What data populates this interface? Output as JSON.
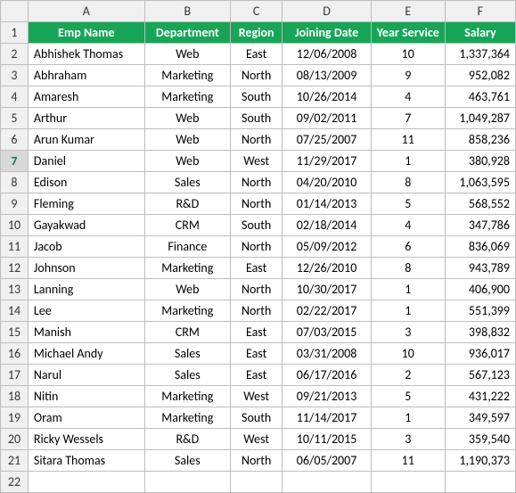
{
  "columns": [
    "A",
    "B",
    "C",
    "D",
    "E",
    "F"
  ],
  "headers": {
    "A": "Emp Name",
    "B": "Department",
    "C": "Region",
    "D": "Joining Date",
    "E": "Year Service",
    "F": "Salary"
  },
  "rows": [
    {
      "n": "2",
      "name": "Abhishek Thomas",
      "dept": "Web",
      "region": "East",
      "date": "12/06/2008",
      "years": "10",
      "salary": "1,337,364"
    },
    {
      "n": "3",
      "name": "Abhraham",
      "dept": "Marketing",
      "region": "North",
      "date": "08/13/2009",
      "years": "9",
      "salary": "952,082"
    },
    {
      "n": "4",
      "name": "Amaresh",
      "dept": "Marketing",
      "region": "South",
      "date": "10/26/2014",
      "years": "4",
      "salary": "463,761"
    },
    {
      "n": "5",
      "name": "Arthur",
      "dept": "Web",
      "region": "South",
      "date": "09/02/2011",
      "years": "7",
      "salary": "1,049,287"
    },
    {
      "n": "6",
      "name": "Arun Kumar",
      "dept": "Web",
      "region": "North",
      "date": "07/25/2007",
      "years": "11",
      "salary": "858,236"
    },
    {
      "n": "7",
      "name": "Daniel",
      "dept": "Web",
      "region": "West",
      "date": "11/29/2017",
      "years": "1",
      "salary": "380,928"
    },
    {
      "n": "8",
      "name": "Edison",
      "dept": "Sales",
      "region": "North",
      "date": "04/20/2010",
      "years": "8",
      "salary": "1,063,595"
    },
    {
      "n": "9",
      "name": "Fleming",
      "dept": "R&D",
      "region": "North",
      "date": "01/14/2013",
      "years": "5",
      "salary": "568,552"
    },
    {
      "n": "10",
      "name": "Gayakwad",
      "dept": "CRM",
      "region": "South",
      "date": "02/18/2014",
      "years": "4",
      "salary": "347,786"
    },
    {
      "n": "11",
      "name": "Jacob",
      "dept": "Finance",
      "region": "North",
      "date": "05/09/2012",
      "years": "6",
      "salary": "836,069"
    },
    {
      "n": "12",
      "name": "Johnson",
      "dept": "Marketing",
      "region": "East",
      "date": "12/26/2010",
      "years": "8",
      "salary": "943,789"
    },
    {
      "n": "13",
      "name": "Lanning",
      "dept": "Web",
      "region": "North",
      "date": "10/30/2017",
      "years": "1",
      "salary": "406,900"
    },
    {
      "n": "14",
      "name": "Lee",
      "dept": "Marketing",
      "region": "North",
      "date": "02/22/2017",
      "years": "1",
      "salary": "551,399"
    },
    {
      "n": "15",
      "name": "Manish",
      "dept": "CRM",
      "region": "East",
      "date": "07/03/2015",
      "years": "3",
      "salary": "398,832"
    },
    {
      "n": "16",
      "name": "Michael Andy",
      "dept": "Sales",
      "region": "East",
      "date": "03/31/2008",
      "years": "10",
      "salary": "936,017"
    },
    {
      "n": "17",
      "name": "Narul",
      "dept": "Sales",
      "region": "East",
      "date": "06/17/2016",
      "years": "2",
      "salary": "567,123"
    },
    {
      "n": "18",
      "name": "Nitin",
      "dept": "Marketing",
      "region": "West",
      "date": "09/21/2013",
      "years": "5",
      "salary": "431,222"
    },
    {
      "n": "19",
      "name": "Oram",
      "dept": "Marketing",
      "region": "South",
      "date": "11/14/2017",
      "years": "1",
      "salary": "349,597"
    },
    {
      "n": "20",
      "name": "Ricky Wessels",
      "dept": "R&D",
      "region": "West",
      "date": "10/11/2015",
      "years": "3",
      "salary": "359,540"
    },
    {
      "n": "21",
      "name": "Sitara Thomas",
      "dept": "Sales",
      "region": "North",
      "date": "06/05/2007",
      "years": "11",
      "salary": "1,190,373"
    }
  ],
  "active_row": "7",
  "trailing_row": "22"
}
